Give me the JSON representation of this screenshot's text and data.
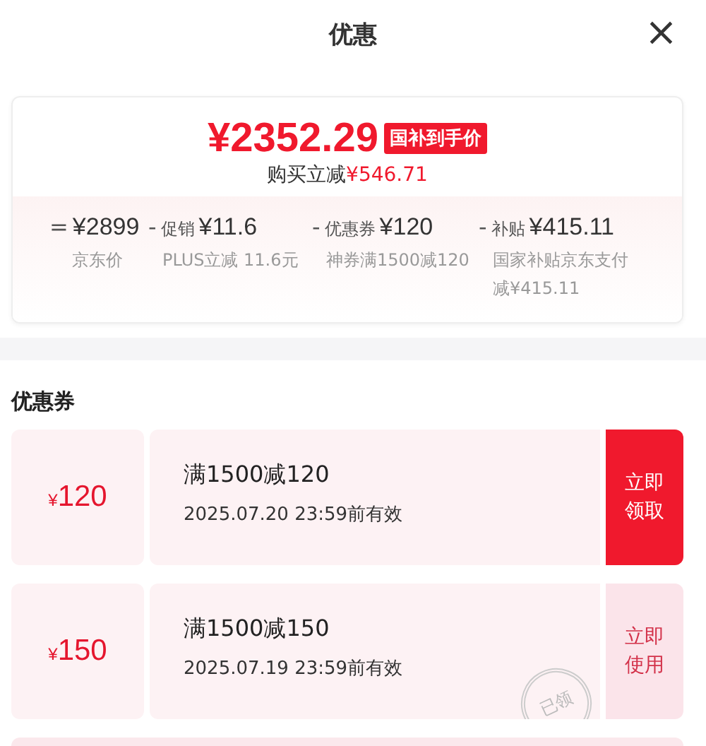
{
  "header": {
    "title": "优惠",
    "close": "×"
  },
  "price": {
    "amount": "¥2352.29",
    "tag": "国补到手价",
    "saving_label": "购买立减",
    "saving": "¥546.71"
  },
  "breakdown": [
    {
      "op": "=",
      "amount": "¥2899",
      "note": "京东价"
    },
    {
      "op": "-",
      "label": "促销",
      "amount": "¥11.6",
      "note": "PLUS立减 11.6元"
    },
    {
      "op": "-",
      "label": "优惠券",
      "amount": "¥120",
      "note": "神券满1500减120"
    },
    {
      "op": "-",
      "label": "补贴",
      "amount": "¥415.11",
      "note": "国家补贴京东支付减¥415.11"
    }
  ],
  "coupon_section": {
    "title": "优惠券"
  },
  "coupons": [
    {
      "currency": "¥",
      "value": "120",
      "rule": "满1500减120",
      "expiry": "2025.07.20 23:59前有效",
      "action": "立即领取",
      "claimed": false
    },
    {
      "currency": "¥",
      "value": "150",
      "rule": "满1500减150",
      "expiry": "2025.07.19 23:59前有效",
      "action": "立即使用",
      "claimed": true,
      "stamp": "已领"
    }
  ]
}
